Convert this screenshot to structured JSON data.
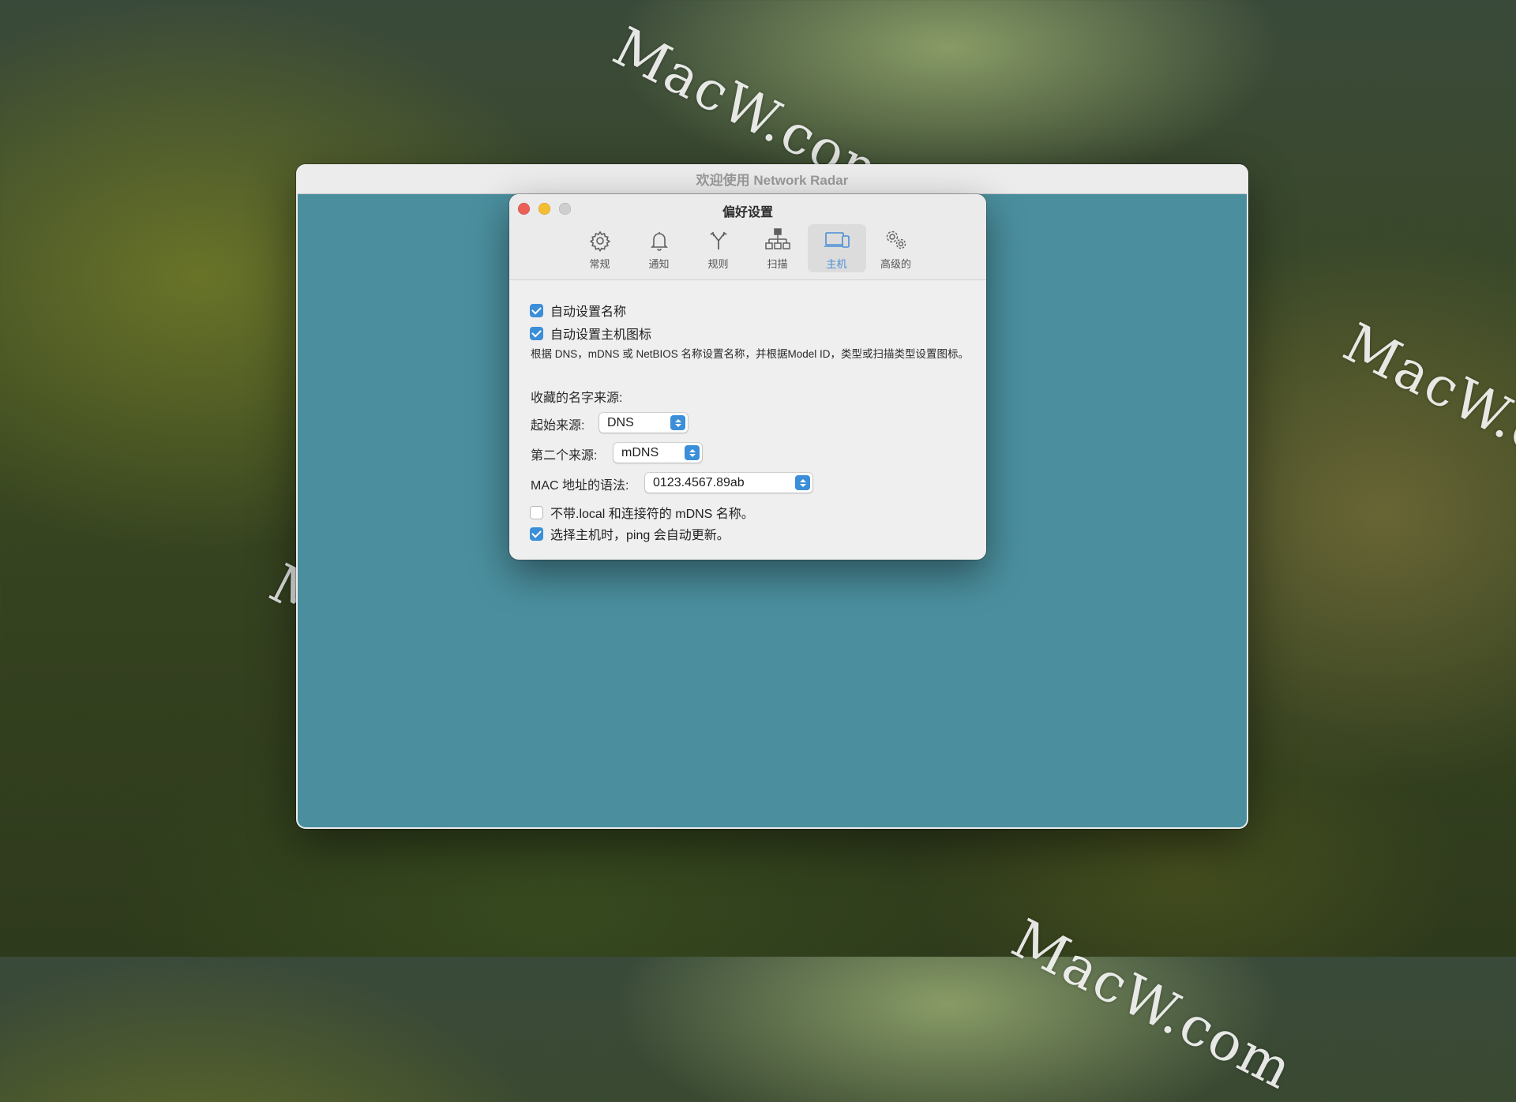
{
  "wallpaper": {
    "watermark_text": "MacW.com"
  },
  "main_window": {
    "title": "欢迎使用 Network Radar",
    "content_color": "#4b8f9e"
  },
  "preferences": {
    "title": "偏好设置",
    "tabs": [
      {
        "label": "常规",
        "icon": "gear-icon",
        "active": false
      },
      {
        "label": "通知",
        "icon": "bell-icon",
        "active": false
      },
      {
        "label": "规则",
        "icon": "fork-icon",
        "active": false
      },
      {
        "label": "扫描",
        "icon": "network-tree-icon",
        "active": false
      },
      {
        "label": "主机",
        "icon": "host-devices-icon",
        "active": true
      },
      {
        "label": "高级的",
        "icon": "gears-icon",
        "active": false
      }
    ],
    "host": {
      "auto_set_name": {
        "label": "自动设置名称",
        "checked": true
      },
      "auto_set_icon": {
        "label": "自动设置主机图标",
        "checked": true
      },
      "description": "根据 DNS，mDNS 或 NetBIOS 名称设置名称，并根据Model ID，类型或扫描类型设置图标。",
      "favorite_sources_label": "收藏的名字来源:",
      "primary_source": {
        "label": "起始来源:",
        "value": "DNS"
      },
      "secondary_source": {
        "label": "第二个来源:",
        "value": "mDNS"
      },
      "mac_syntax": {
        "label": "MAC 地址的语法:",
        "value": "0123.4567.89ab"
      },
      "strip_local": {
        "label": "不带.local 和连接符的 mDNS 名称。",
        "checked": false
      },
      "auto_ping": {
        "label": "选择主机时，ping 会自动更新。",
        "checked": true
      }
    },
    "accent_color": "#3b8ed8"
  }
}
